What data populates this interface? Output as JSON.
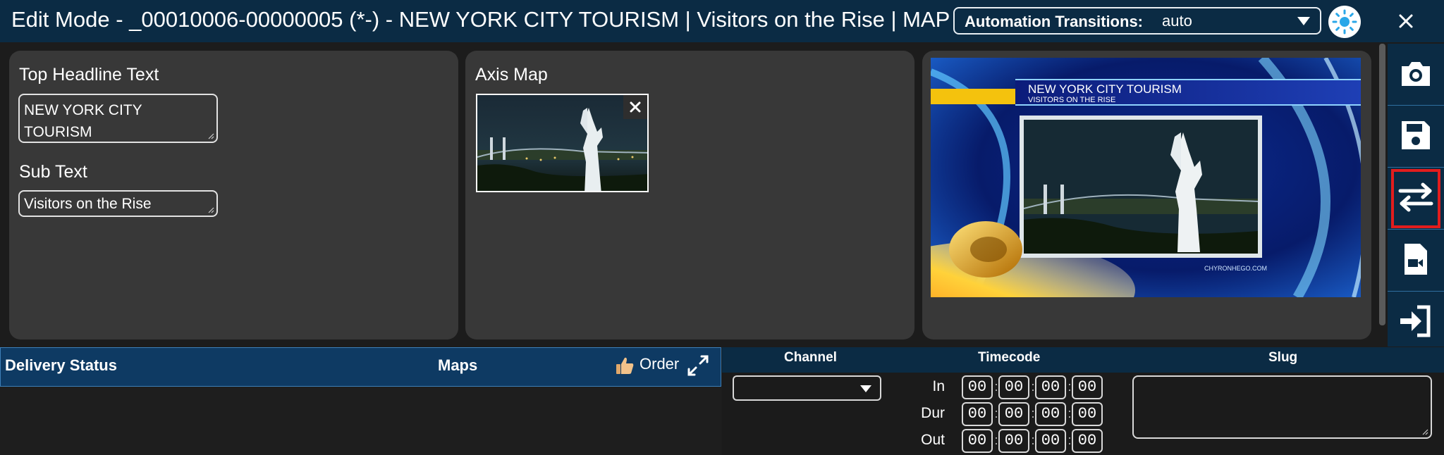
{
  "window": {
    "title": "Edit Mode - _00010006-00000005 (*-) - NEW YORK CITY TOURISM | Visitors on the Rise | MAP | ..."
  },
  "toolbar": {
    "automation_label": "Automation Transitions:",
    "automation_value": "auto",
    "theme_icon": "sun-icon",
    "close_icon": "close-icon"
  },
  "fields": {
    "headline_label": "Top Headline Text",
    "headline_value": "NEW YORK CITY TOURISM",
    "subtext_label": "Sub Text",
    "subtext_value": "Visitors on the Rise"
  },
  "map": {
    "label": "Axis Map"
  },
  "preview": {
    "headline": "NEW YORK CITY TOURISM",
    "subline": "VISITORS ON THE RISE",
    "watermark": "CHYRONHEGO.COM"
  },
  "rail": {
    "items": [
      "camera-icon",
      "save-icon",
      "swap-arrows-icon",
      "video-file-icon",
      "sign-in-icon"
    ],
    "highlight_color": "#e21d1d"
  },
  "grid": {
    "col_delivery": "Delivery Status",
    "col_maps": "Maps",
    "order_label": "Order"
  },
  "meta": {
    "channel_label": "Channel",
    "timecode_label": "Timecode",
    "slug_label": "Slug",
    "in_label": "In",
    "dur_label": "Dur",
    "out_label": "Out",
    "tc_part": "00"
  },
  "colors": {
    "title_bar": "#0b2b44",
    "card": "#383838",
    "grid_header": "#0e3a63"
  }
}
